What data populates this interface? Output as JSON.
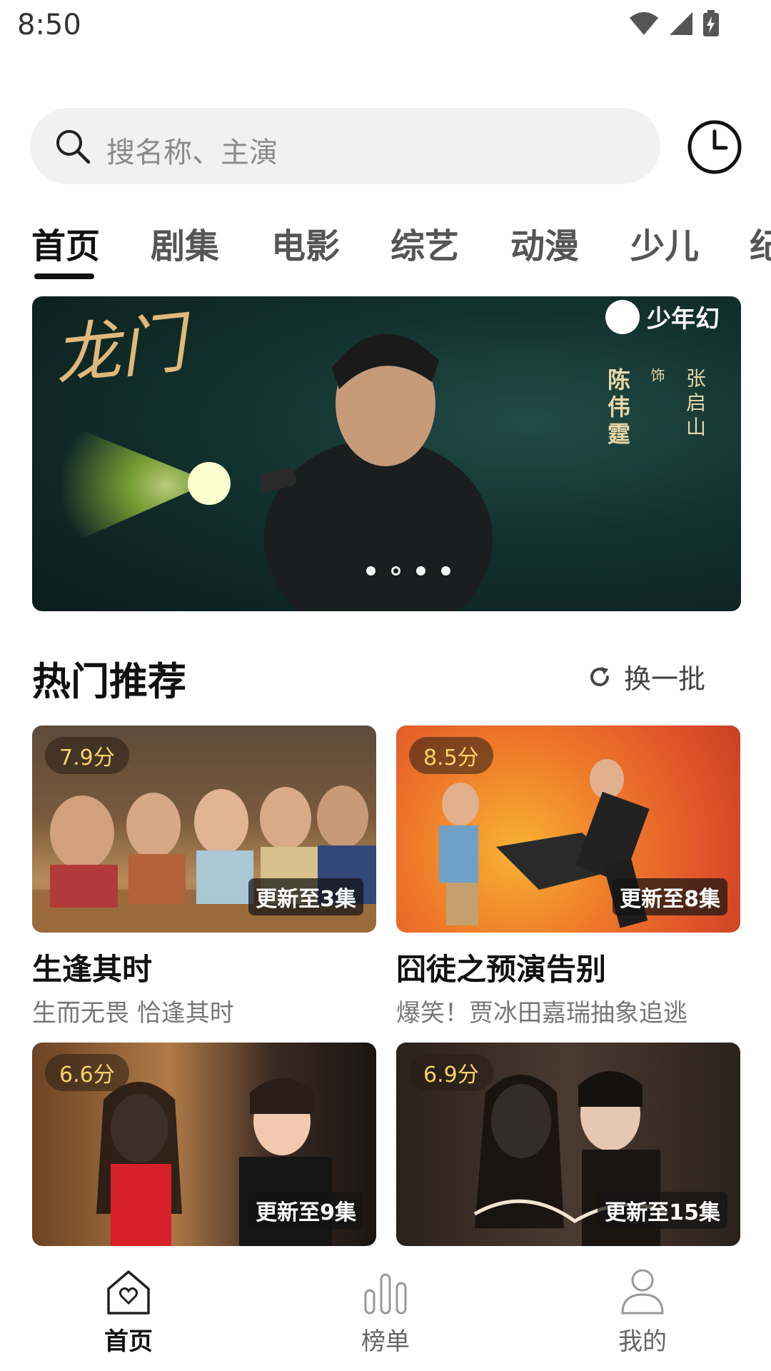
{
  "status_bar": {
    "time": "8:50"
  },
  "search": {
    "placeholder": "搜名称、主演",
    "icon": "search-icon",
    "history_icon": "clock-icon"
  },
  "tabs": [
    {
      "label": "首页",
      "active": true
    },
    {
      "label": "剧集",
      "active": false
    },
    {
      "label": "电影",
      "active": false
    },
    {
      "label": "综艺",
      "active": false
    },
    {
      "label": "动漫",
      "active": false
    },
    {
      "label": "少儿",
      "active": false
    },
    {
      "label": "纪",
      "active": false
    }
  ],
  "banner": {
    "title_art": "龙门",
    "brand": "少年幻",
    "credit": {
      "actor": "陈伟霆",
      "role_prefix": "饰",
      "role": "张启山"
    },
    "dots_count": 4,
    "active_dot": 2
  },
  "section": {
    "title": "热门推荐",
    "refresh_label": "换一批"
  },
  "cards": [
    {
      "score": "7.9分",
      "episodes": "更新至3集",
      "title": "生逢其时",
      "subtitle": "生而无畏 恰逢其时"
    },
    {
      "score": "8.5分",
      "episodes": "更新至8集",
      "title": "囧徒之预演告别",
      "subtitle": "爆笑！贾冰田嘉瑞抽象追逃"
    },
    {
      "score": "6.6分",
      "episodes": "更新至9集",
      "title": "",
      "subtitle": ""
    },
    {
      "score": "6.9分",
      "episodes": "更新至15集",
      "title": "",
      "subtitle": ""
    }
  ],
  "bottom_nav": [
    {
      "label": "首页",
      "icon": "home-heart-icon",
      "active": true
    },
    {
      "label": "榜单",
      "icon": "chart-bars-icon",
      "active": false
    },
    {
      "label": "我的",
      "icon": "user-icon",
      "active": false
    }
  ],
  "colors": {
    "score_text": "#f6d36a",
    "active_text": "#111111",
    "inactive_text": "#555555"
  }
}
